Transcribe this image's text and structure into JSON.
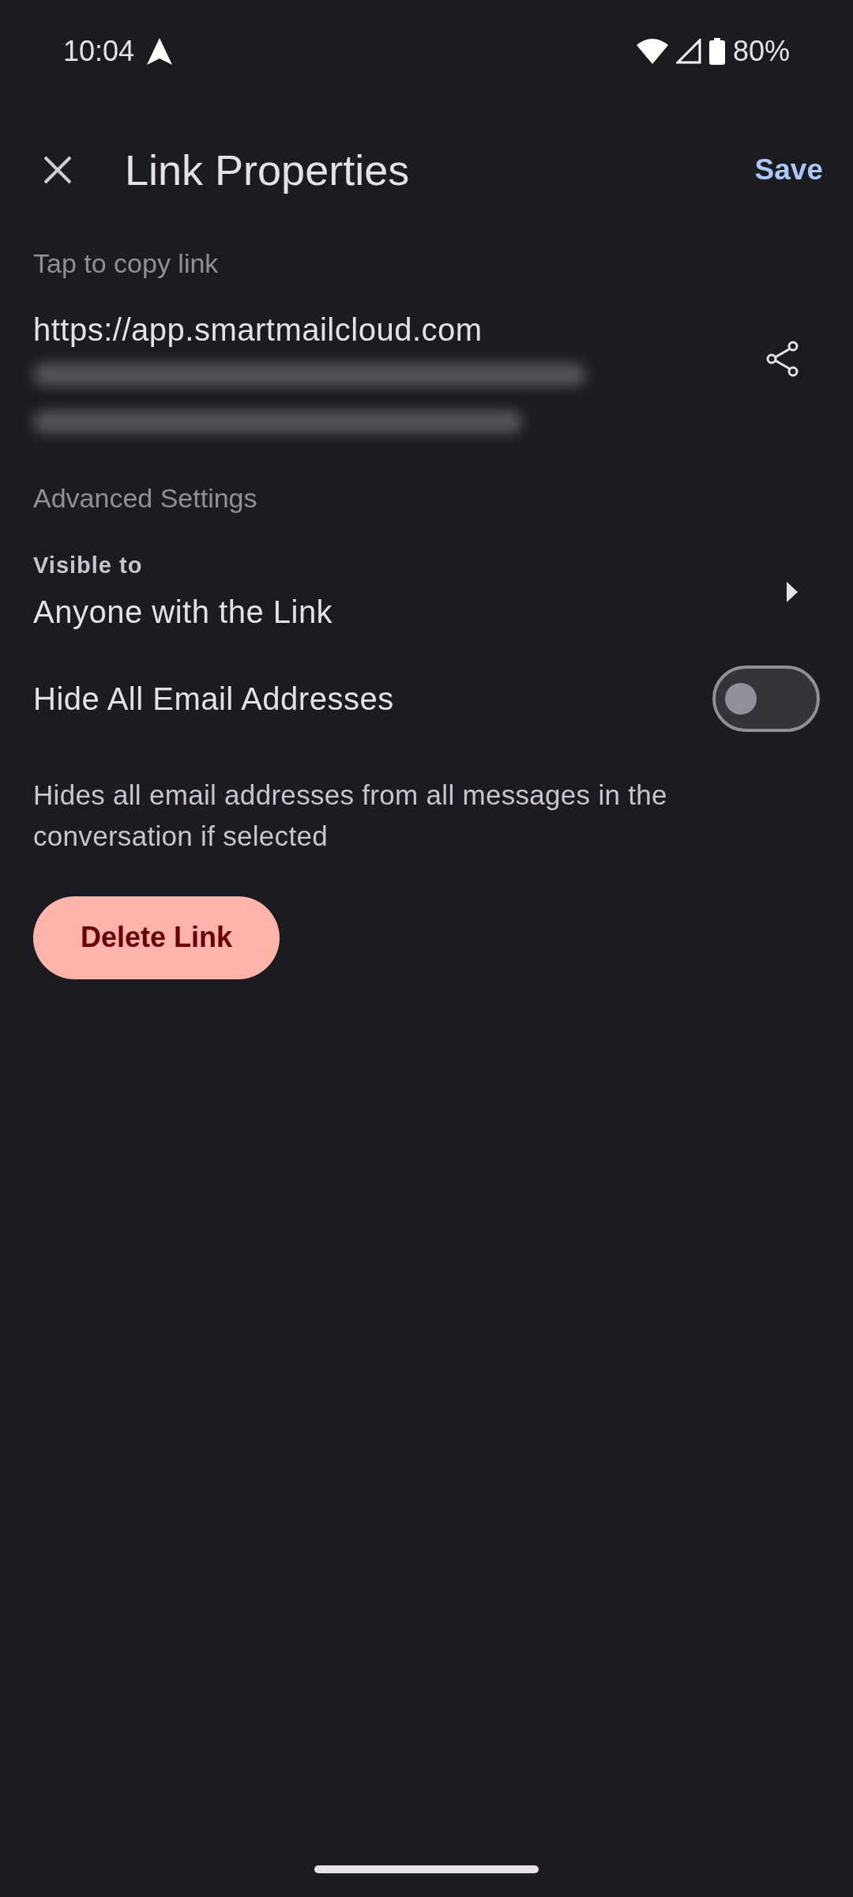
{
  "status_bar": {
    "time": "10:04",
    "battery": "80%"
  },
  "toolbar": {
    "title": "Link Properties",
    "save": "Save"
  },
  "link": {
    "label": "Tap to copy link",
    "url": "https://app.smartmailcloud.com"
  },
  "advanced": {
    "heading": "Advanced Settings",
    "visibility": {
      "label": "Visible to",
      "value": "Anyone with the Link"
    },
    "hide_emails": {
      "label": "Hide All Email Addresses",
      "on": false,
      "description": "Hides all email addresses from all messages in the conversation if selected"
    }
  },
  "delete_button": "Delete Link"
}
